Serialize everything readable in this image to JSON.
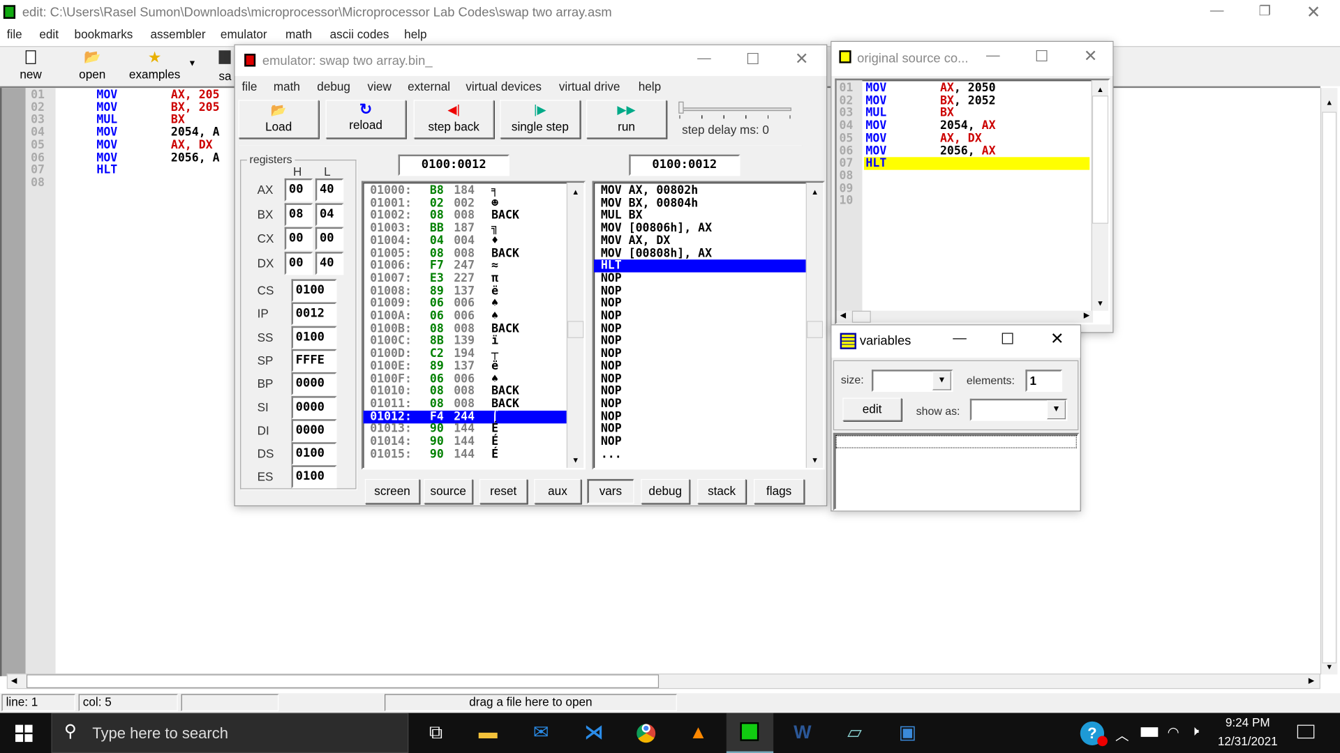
{
  "editor": {
    "title": "edit: C:\\Users\\Rasel Sumon\\Downloads\\microprocessor\\Microprocessor Lab Codes\\swap two array.asm",
    "menu": [
      "file",
      "edit",
      "bookmarks",
      "assembler",
      "emulator",
      "math",
      "ascii codes",
      "help"
    ],
    "toolbar": {
      "new": "new",
      "open": "open",
      "examples": "examples",
      "save": "sa"
    },
    "lines": [
      {
        "n": "01",
        "op": "MOV",
        "a": "AX, 205",
        "ac": "r"
      },
      {
        "n": "02",
        "op": "MOV",
        "a": "BX, 205",
        "ac": "r"
      },
      {
        "n": "03",
        "op": "MUL",
        "a": "BX",
        "ac": "r"
      },
      {
        "n": "04",
        "op": "MOV",
        "a": "2054, A",
        "ac": "k"
      },
      {
        "n": "05",
        "op": "MOV",
        "a": "AX, DX",
        "ac": "r"
      },
      {
        "n": "06",
        "op": "MOV",
        "a": "2056, A",
        "ac": "k"
      },
      {
        "n": "07",
        "op": "HLT",
        "a": "",
        "ac": "k"
      },
      {
        "n": "08",
        "op": "",
        "a": "",
        "ac": "k"
      }
    ],
    "status": {
      "line": "line: 1",
      "col": "col: 5",
      "drop": "drag a file here to open"
    }
  },
  "emulator": {
    "title": "emulator: swap two array.bin_",
    "menu": [
      "file",
      "math",
      "debug",
      "view",
      "external",
      "virtual devices",
      "virtual drive",
      "help"
    ],
    "buttons": {
      "load": "Load",
      "reload": "reload",
      "step_back": "step back",
      "single_step": "single step",
      "run": "run"
    },
    "step_delay": "step delay ms: 0",
    "step_delay_value": 0,
    "registers_label": "registers",
    "h": "H",
    "l": "L",
    "gp": [
      {
        "name": "AX",
        "h": "00",
        "l": "40"
      },
      {
        "name": "BX",
        "h": "08",
        "l": "04"
      },
      {
        "name": "CX",
        "h": "00",
        "l": "00"
      },
      {
        "name": "DX",
        "h": "00",
        "l": "40"
      }
    ],
    "seg": [
      {
        "name": "CS",
        "v": "0100"
      },
      {
        "name": "IP",
        "v": "0012"
      },
      {
        "name": "SS",
        "v": "0100"
      },
      {
        "name": "SP",
        "v": "FFFE"
      },
      {
        "name": "BP",
        "v": "0000"
      },
      {
        "name": "SI",
        "v": "0000"
      },
      {
        "name": "DI",
        "v": "0000"
      },
      {
        "name": "DS",
        "v": "0100"
      },
      {
        "name": "ES",
        "v": "0100"
      }
    ],
    "addr_left": "0100:0012",
    "addr_right": "0100:0012",
    "memory": [
      [
        "01000:",
        "B8",
        "184",
        "╕"
      ],
      [
        "01001:",
        "02",
        "002",
        "☻"
      ],
      [
        "01002:",
        "08",
        "008",
        "BACK"
      ],
      [
        "01003:",
        "BB",
        "187",
        "╗"
      ],
      [
        "01004:",
        "04",
        "004",
        "♦"
      ],
      [
        "01005:",
        "08",
        "008",
        "BACK"
      ],
      [
        "01006:",
        "F7",
        "247",
        "≈"
      ],
      [
        "01007:",
        "E3",
        "227",
        "π"
      ],
      [
        "01008:",
        "89",
        "137",
        "ë"
      ],
      [
        "01009:",
        "06",
        "006",
        "♠"
      ],
      [
        "0100A:",
        "06",
        "006",
        "♠"
      ],
      [
        "0100B:",
        "08",
        "008",
        "BACK"
      ],
      [
        "0100C:",
        "8B",
        "139",
        "ï"
      ],
      [
        "0100D:",
        "C2",
        "194",
        "┬"
      ],
      [
        "0100E:",
        "89",
        "137",
        "ë"
      ],
      [
        "0100F:",
        "06",
        "006",
        "♠"
      ],
      [
        "01010:",
        "08",
        "008",
        "BACK"
      ],
      [
        "01011:",
        "08",
        "008",
        "BACK"
      ],
      [
        "01012:",
        "F4",
        "244",
        "⌠"
      ],
      [
        "01013:",
        "90",
        "144",
        "É"
      ],
      [
        "01014:",
        "90",
        "144",
        "É"
      ],
      [
        "01015:",
        "90",
        "144",
        "É"
      ]
    ],
    "memory_selected": 18,
    "disasm": [
      "MOV AX, 00802h",
      "MOV BX, 00804h",
      "MUL BX",
      "MOV [00806h], AX",
      "MOV AX, DX",
      "MOV [00808h], AX",
      "HLT",
      "NOP",
      "NOP",
      "NOP",
      "NOP",
      "NOP",
      "NOP",
      "NOP",
      "NOP",
      "NOP",
      "NOP",
      "NOP",
      "NOP",
      "NOP",
      "NOP",
      "..."
    ],
    "disasm_selected": 6,
    "bottom": [
      "screen",
      "source",
      "reset",
      "aux",
      "vars",
      "debug",
      "stack",
      "flags"
    ]
  },
  "source": {
    "title": "original source co...",
    "lines": [
      {
        "n": "01",
        "op": "MOV",
        "a": "AX",
        "b": ", 2050"
      },
      {
        "n": "02",
        "op": "MOV",
        "a": "BX",
        "b": ", 2052"
      },
      {
        "n": "03",
        "op": "MUL",
        "a": "BX",
        "b": ""
      },
      {
        "n": "04",
        "op": "MOV",
        "k": "2054, ",
        "a": "AX",
        "b": ""
      },
      {
        "n": "05",
        "op": "MOV",
        "a": "AX, DX",
        "b": ""
      },
      {
        "n": "06",
        "op": "MOV",
        "k": "2056, ",
        "a": "AX",
        "b": ""
      },
      {
        "n": "07",
        "op": "HLT",
        "a": "",
        "b": ""
      },
      {
        "n": "08",
        "op": "",
        "a": "",
        "b": ""
      },
      {
        "n": "09",
        "op": "",
        "a": "",
        "b": ""
      },
      {
        "n": "10",
        "op": "",
        "a": "",
        "b": ""
      }
    ],
    "highlight": 6
  },
  "variables": {
    "title": "variables",
    "size_label": "size:",
    "elements_label": "elements:",
    "elements": "1",
    "edit": "edit",
    "show_as": "show as:",
    "size_value": "",
    "show_value": ""
  },
  "taskbar": {
    "search": "Type here to search",
    "time": "9:24 PM",
    "date": "12/31/2021"
  },
  "colors": {
    "keyword": "#0000ff",
    "register": "#cc0000",
    "hex": "#008000",
    "addr": "#808080",
    "select": "#0000ff",
    "highlight": "#ffff00",
    "taskbar": "#101010"
  }
}
